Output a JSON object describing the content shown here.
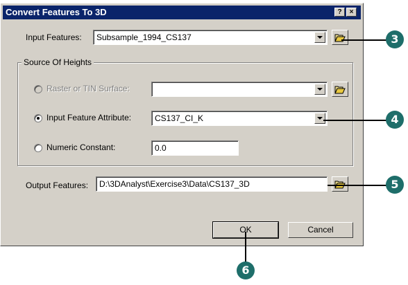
{
  "window": {
    "title": "Convert Features To 3D",
    "help_label": "?",
    "close_label": "×"
  },
  "input_features": {
    "label": "Input Features:",
    "value": "Subsample_1994_CS137"
  },
  "source_of_heights": {
    "legend": "Source Of Heights",
    "raster_tin": {
      "label": "Raster or TIN Surface:",
      "value": "",
      "enabled": false,
      "selected": false
    },
    "feature_attribute": {
      "label": "Input Feature Attribute:",
      "value": "CS137_CI_K",
      "selected": true
    },
    "numeric_constant": {
      "label": "Numeric Constant:",
      "value": "0.0",
      "selected": false
    }
  },
  "output_features": {
    "label": "Output Features:",
    "value": "D:\\3DAnalyst\\Exercise3\\Data\\CS137_3D"
  },
  "buttons": {
    "ok": "OK",
    "cancel": "Cancel"
  },
  "callouts": [
    "3",
    "4",
    "5",
    "6"
  ],
  "colors": {
    "titlebar": "#0a246a",
    "dialog_bg": "#d4d0c8",
    "callout": "#1e6e6a"
  }
}
